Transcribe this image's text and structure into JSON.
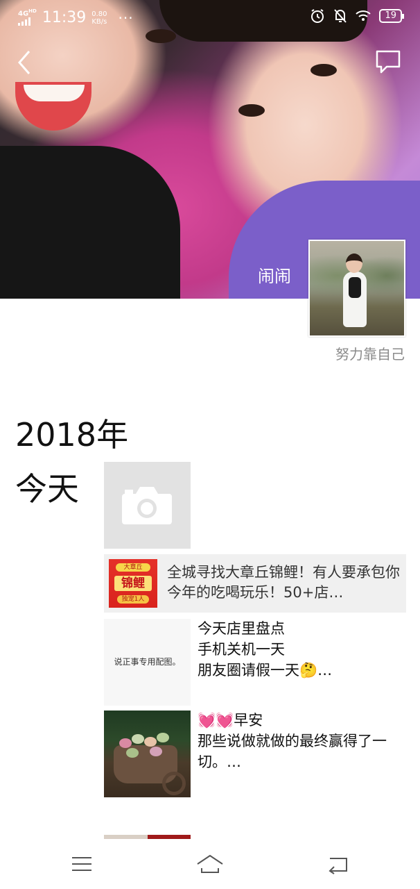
{
  "status_bar": {
    "network": "4G",
    "network_sup": "HD",
    "time": "11:39",
    "speed_value": "0.80",
    "speed_unit": "KB/s",
    "more": "···",
    "battery": "19"
  },
  "cover": {
    "name": "闹闹",
    "signature": "努力靠自己"
  },
  "timeline": {
    "year": "2018年",
    "day_label": "今天"
  },
  "share_card": {
    "thumb_top": "大章丘",
    "thumb_title": "锦鲤",
    "thumb_bottom": "独宠1人",
    "text": "全城寻找大章丘锦鲤！有人要承包你今年的吃喝玩乐！50+店…"
  },
  "posts": [
    {
      "thumb_text": "说正事专用配图。",
      "lines": [
        "今天店里盘点",
        "手机关机一天",
        "朋友圈请假一天🤔…"
      ]
    },
    {
      "lines": [
        "💓💓早安",
        "那些说做就做的最终赢得了一切。…"
      ]
    }
  ],
  "icons": {
    "back": "chevron-left-icon",
    "message": "message-icon",
    "camera": "camera-icon",
    "menu": "menu-icon",
    "home": "home-icon",
    "return": "return-icon"
  },
  "colors": {
    "card_bg": "#f0f0f0",
    "tile_bg": "#e2e2e2",
    "signature": "#8a8a8a"
  }
}
